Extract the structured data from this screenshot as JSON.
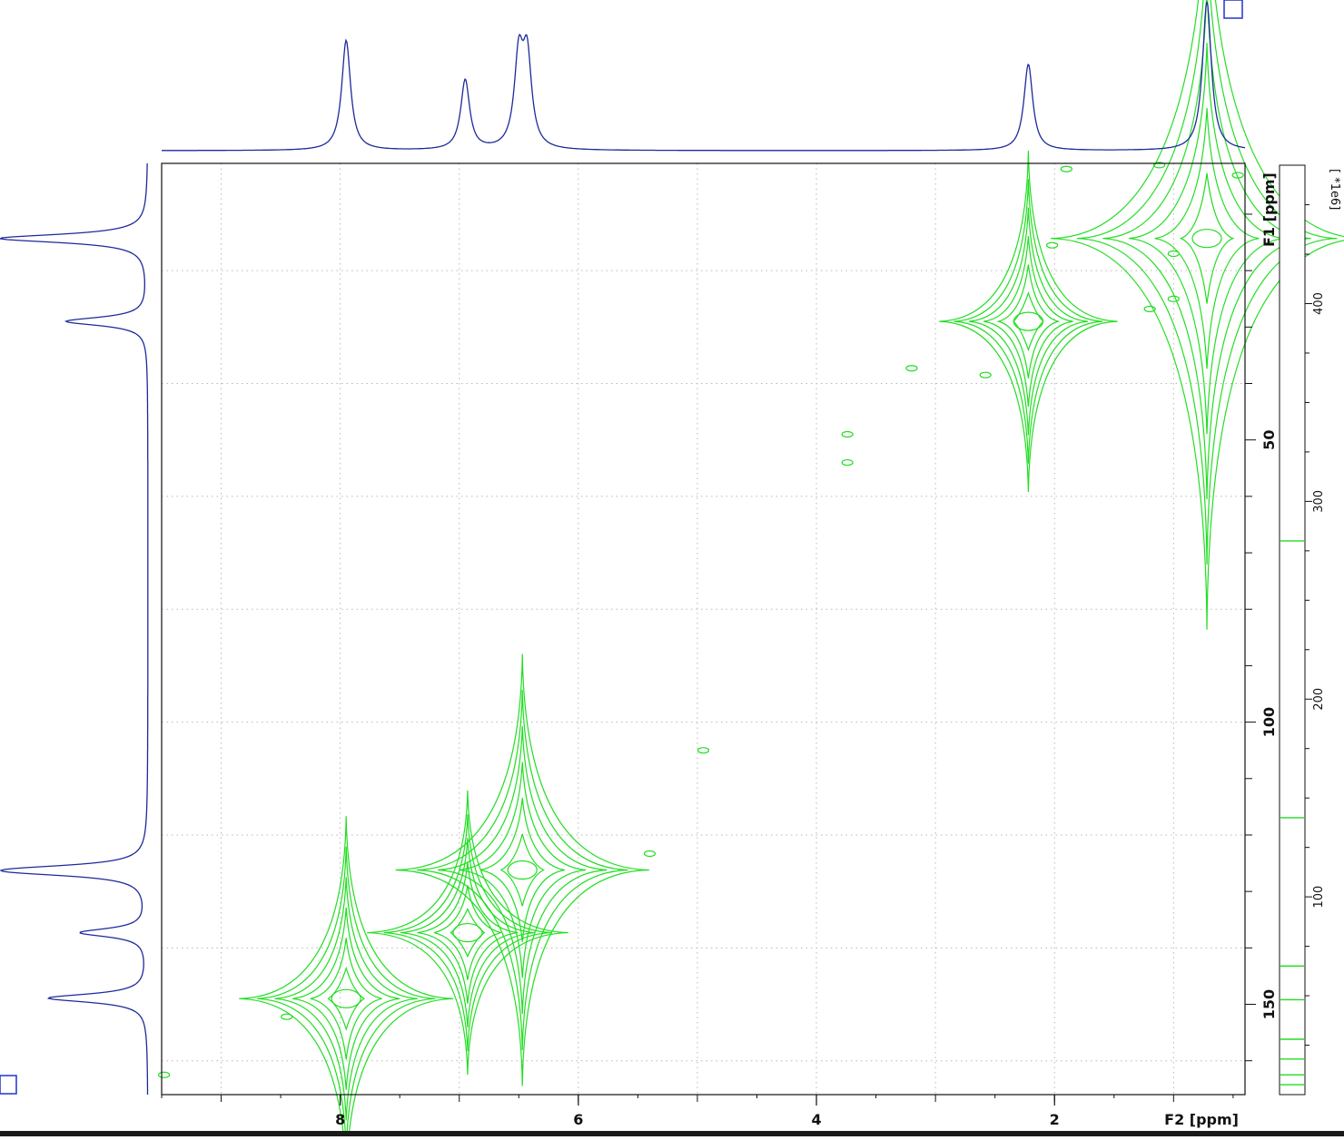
{
  "chart_data": {
    "type": "contour",
    "xlabel": "F2 [ppm]",
    "ylabel": "F1 [ppm]",
    "x_axis": {
      "range": [
        9.5,
        0.4
      ],
      "reversed": true,
      "major_ticks": [
        8,
        6,
        4,
        2
      ],
      "tick_labels": [
        "8",
        "6",
        "4",
        "2"
      ]
    },
    "y_axis": {
      "range": [
        1,
        166
      ],
      "reversed": true,
      "major_ticks": [
        50,
        100,
        150
      ],
      "tick_labels": [
        "50",
        "100",
        "150"
      ]
    },
    "colorbar": {
      "unit_label": "[ *1e6]",
      "tick_labels": [
        "400",
        "300",
        "200",
        "100"
      ],
      "ticks": [
        400,
        300,
        200,
        100
      ],
      "range": [
        0,
        470
      ],
      "contour_levels": [
        5,
        10,
        18,
        28,
        48,
        65,
        140,
        280
      ]
    },
    "grid": true,
    "contour_color": "#22dd22",
    "projection_color": "#1c2a9a",
    "f2_projection": [
      {
        "ppm": 7.95,
        "intensity": 0.74
      },
      {
        "ppm": 6.95,
        "intensity": 0.47
      },
      {
        "ppm": 6.5,
        "intensity": 0.59
      },
      {
        "ppm": 6.43,
        "intensity": 0.59
      },
      {
        "ppm": 2.22,
        "intensity": 0.58
      },
      {
        "ppm": 0.72,
        "intensity": 1.0
      }
    ],
    "f1_projection": [
      {
        "ppm": 14.3,
        "intensity": 1.0
      },
      {
        "ppm": 29.0,
        "intensity": 0.55
      },
      {
        "ppm": 126.0,
        "intensity": 0.55
      },
      {
        "ppm": 126.6,
        "intensity": 0.55
      },
      {
        "ppm": 137.3,
        "intensity": 0.45
      },
      {
        "ppm": 148.9,
        "intensity": 0.67
      }
    ],
    "peaks": [
      {
        "f2": 0.72,
        "f1": 14.3,
        "width": 9,
        "height": 85,
        "strength": 1.0
      },
      {
        "f2": 2.22,
        "f1": 29.0,
        "width": 7,
        "height": 52,
        "strength": 0.7
      },
      {
        "f2": 6.47,
        "f1": 126.2,
        "width": 9,
        "height": 58,
        "strength": 0.8
      },
      {
        "f2": 6.93,
        "f1": 137.3,
        "width": 8,
        "height": 43,
        "strength": 0.7
      },
      {
        "f2": 7.95,
        "f1": 149.0,
        "width": 8,
        "height": 52,
        "strength": 0.75
      }
    ],
    "minor_spots": [
      {
        "f2": 1.9,
        "f1": 2.0
      },
      {
        "f2": 1.12,
        "f1": 1.3
      },
      {
        "f2": 0.46,
        "f1": 3.1
      },
      {
        "f2": 1.0,
        "f1": 25.0
      },
      {
        "f2": 1.2,
        "f1": 26.8
      },
      {
        "f2": 3.74,
        "f1": 49.0
      },
      {
        "f2": 2.58,
        "f1": 38.5
      },
      {
        "f2": 3.2,
        "f1": 37.3
      },
      {
        "f2": 4.95,
        "f1": 105.0
      },
      {
        "f2": 5.4,
        "f1": 123.3
      },
      {
        "f2": 8.45,
        "f1": 152.2
      },
      {
        "f2": 9.48,
        "f1": 162.5
      },
      {
        "f2": 2.02,
        "f1": 15.5
      },
      {
        "f2": 1.0,
        "f1": 17.0
      },
      {
        "f2": 3.74,
        "f1": 54.0
      }
    ]
  }
}
